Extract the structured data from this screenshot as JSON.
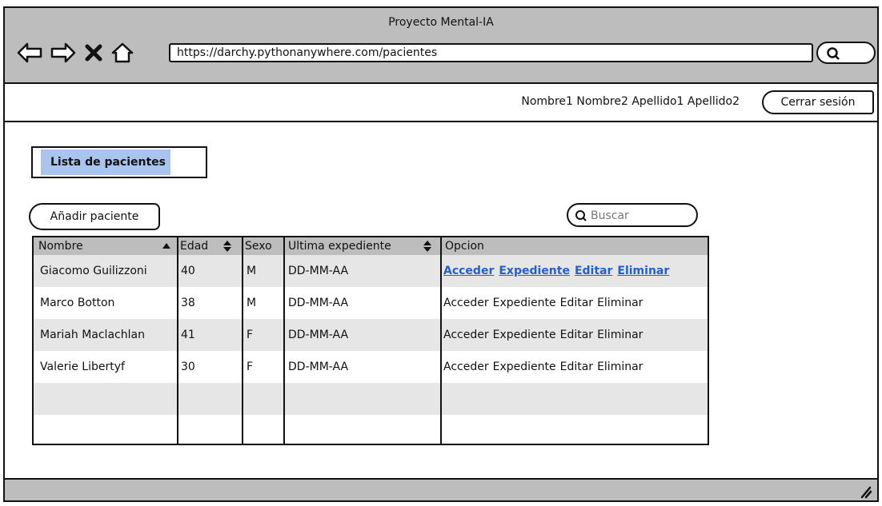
{
  "window": {
    "title": "Proyecto Mental-IA"
  },
  "browser": {
    "url": "https://darchy.pythonanywhere.com/pacientes",
    "icons": [
      "back-arrow-icon",
      "forward-arrow-icon",
      "close-icon",
      "home-icon",
      "search-icon"
    ]
  },
  "user": {
    "name": "Nombre1 Nombre2 Apellido1 Apellido2",
    "logout_label": "Cerrar sesión"
  },
  "page": {
    "tab_label": "Lista de pacientes",
    "add_label": "Añadir paciente",
    "search_placeholder": "Buscar"
  },
  "table": {
    "headers": {
      "nombre": "Nombre",
      "edad": "Edad",
      "sexo": "Sexo",
      "ultima": "Ultima expediente",
      "opcion": "Opcion"
    },
    "rows": [
      {
        "nombre": "Giacomo Guilizzoni",
        "edad": "40",
        "sexo": "M",
        "ultima": "DD-MM-AA"
      },
      {
        "nombre": "Marco Botton",
        "edad": "38",
        "sexo": "M",
        "ultima": "DD-MM-AA"
      },
      {
        "nombre": "Mariah Maclachlan",
        "edad": "41",
        "sexo": "F",
        "ultima": "DD-MM-AA"
      },
      {
        "nombre": "Valerie Libertyf",
        "edad": "30",
        "sexo": "F",
        "ultima": "DD-MM-AA"
      }
    ],
    "actions": {
      "acceder": "Acceder",
      "expediente": "Expediente",
      "editar": "Editar",
      "eliminar": "Eliminar"
    }
  },
  "colors": {
    "chrome": "#bdbdbd",
    "highlight": "#a9c4ee",
    "link": "#2260cc",
    "alt_row": "#e6e6e6"
  }
}
